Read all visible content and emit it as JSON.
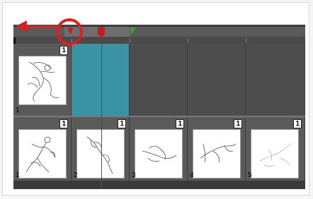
{
  "timeline": {
    "row1": {
      "frame": {
        "number": "1",
        "exposure": "1"
      }
    },
    "row2": {
      "frames": [
        {
          "number": "1",
          "exposure": "1"
        },
        {
          "number": "2",
          "exposure": "1"
        },
        {
          "number": "3",
          "exposure": "1"
        },
        {
          "number": "4",
          "exposure": "1"
        },
        {
          "number": "5",
          "exposure": "1"
        }
      ]
    }
  },
  "colors": {
    "selected_cell": "#3a92a2",
    "playhead": "#e01010",
    "start_marker": "#c81a1a",
    "end_marker": "#3aa53a",
    "annotation": "#dd1f1f"
  },
  "icons": {
    "start_marker": "red-triangle-icon",
    "end_marker": "green-triangle-icon",
    "playhead": "playhead-icon",
    "annotation_arrow": "left-arrow-icon"
  }
}
